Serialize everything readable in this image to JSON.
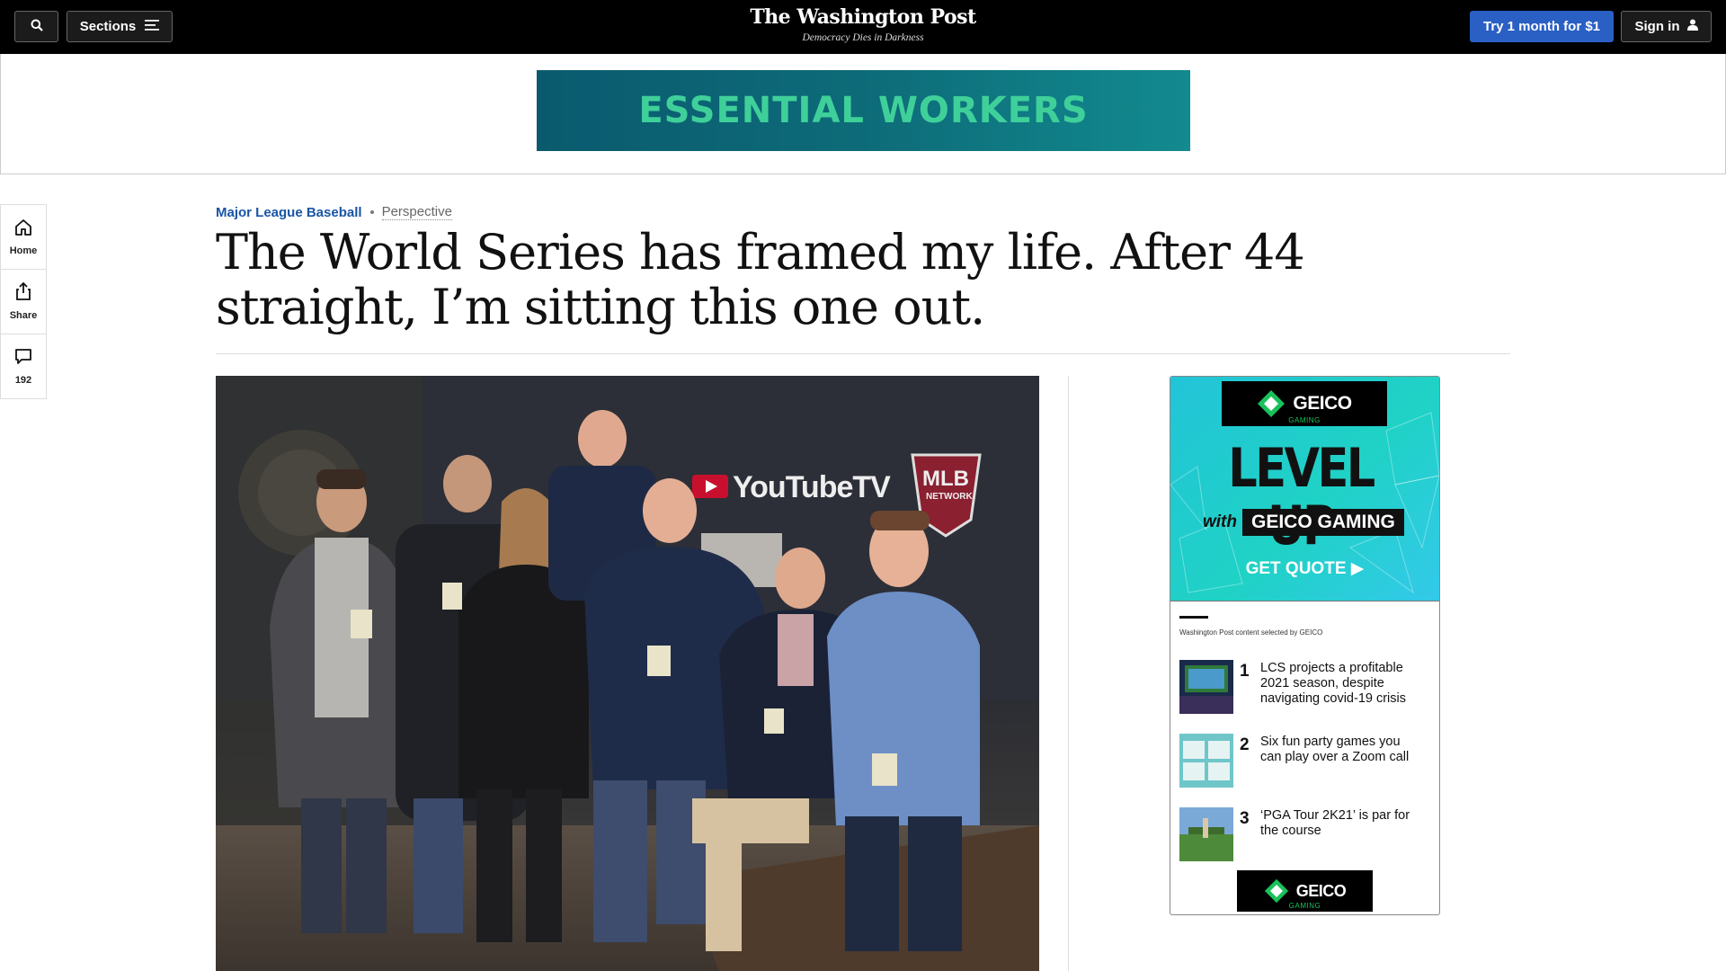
{
  "header": {
    "search_icon": "search-icon",
    "sections_label": "Sections",
    "logo_text": "The Washington Post",
    "tagline": "Democracy Dies in Darkness",
    "subscribe_label": "Try 1 month for $1",
    "signin_label": "Sign in"
  },
  "top_ad": {
    "text": "ESSENTIAL WORKERS"
  },
  "rail": {
    "home_label": "Home",
    "share_label": "Share",
    "comments_count": "192"
  },
  "article": {
    "section": "Major League Baseball",
    "label": "Perspective",
    "headline": "The World Series has framed my life. After 44 straight, I’m sitting this one out."
  },
  "photo": {
    "sign_youtube": "YouTubeTV",
    "sign_mlb": "MLB",
    "sign_network": "NETWORK"
  },
  "side_ad": {
    "brand": "GEICO",
    "brand_sub": "GAMING",
    "headline": "LEVEL UP",
    "with": "with",
    "with_brand": "GEICO GAMING",
    "cta": "GET QUOTE ▶",
    "selected_by": "Washington Post content selected by GEICO",
    "items": [
      {
        "num": "1",
        "title": "LCS projects a profitable 2021 season, despite navigating covid-19 crisis"
      },
      {
        "num": "2",
        "title": "Six fun party games you can play over a Zoom call"
      },
      {
        "num": "3",
        "title": "‘PGA Tour 2K21’ is par for the course"
      }
    ]
  },
  "colors": {
    "accent_blue": "#2a5fc4",
    "section_blue": "#1955a5",
    "ad_teal": "#0d6b78",
    "ad_green_text": "#3fd09a"
  }
}
